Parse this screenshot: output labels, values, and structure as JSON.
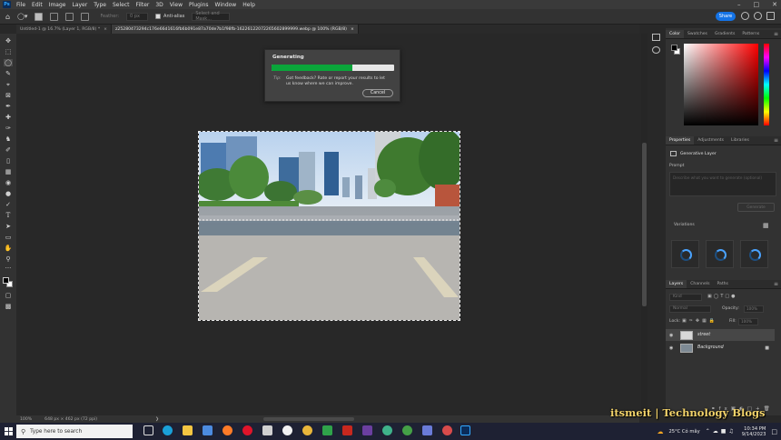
{
  "menubar": {
    "app_icon": "Ps",
    "items": [
      "File",
      "Edit",
      "Image",
      "Layer",
      "Type",
      "Select",
      "Filter",
      "3D",
      "View",
      "Plugins",
      "Window",
      "Help"
    ]
  },
  "options_bar": {
    "feather_label": "Feather:",
    "feather_value": "0 px",
    "antialias_label": "Anti-alias",
    "select_mask_label": "Select and Mask...",
    "share_label": "Share"
  },
  "tabs": [
    {
      "label": "Untitled-1 @ 16.7% (Layer 1, RGB/8) *",
      "active": false
    },
    {
      "label": "z25280473294c176e66d1616fb6b091e87a70de7b1f98fb-16226122072265602899999.webp @ 100% (RGB/8)",
      "active": true
    }
  ],
  "generating_dialog": {
    "title": "Generating",
    "progress_fraction": 0.66,
    "tip_label": "Tip:",
    "tip_text": "Got feedback? Rate or report your results to let us know where we can improve.",
    "cancel_label": "Cancel"
  },
  "color_panel": {
    "tabs": [
      "Color",
      "Swatches",
      "Gradients",
      "Patterns"
    ],
    "foreground": "#000000",
    "background": "#ffffff"
  },
  "properties_panel": {
    "tabs": [
      "Properties",
      "Adjustments",
      "Libraries"
    ],
    "layer_type": "Generative Layer",
    "prompt_label": "Prompt",
    "prompt_placeholder": "Describe what you want to generate (optional)",
    "generate_label": "Generate",
    "variations_label": "Variations"
  },
  "layers_panel": {
    "tabs": [
      "Layers",
      "Channels",
      "Paths"
    ],
    "kind_label": "Kind",
    "blend_mode": "Normal",
    "opacity_label": "Opacity:",
    "opacity_value": "100%",
    "lock_label": "Lock:",
    "fill_label": "Fill:",
    "fill_value": "100%",
    "layers": [
      {
        "name": "street",
        "selected": true
      },
      {
        "name": "Background",
        "selected": false
      }
    ]
  },
  "status_bar": {
    "zoom": "100%",
    "doc_size": "648 px × 462 px (72 ppi)"
  },
  "watermark": "itsmeit | Technology Blogs",
  "taskbar": {
    "search_placeholder": "Type here to search",
    "weather": "25°C  Có mây",
    "time": "10:34 PM",
    "date": "9/14/2023",
    "accent": "#1473e6"
  }
}
